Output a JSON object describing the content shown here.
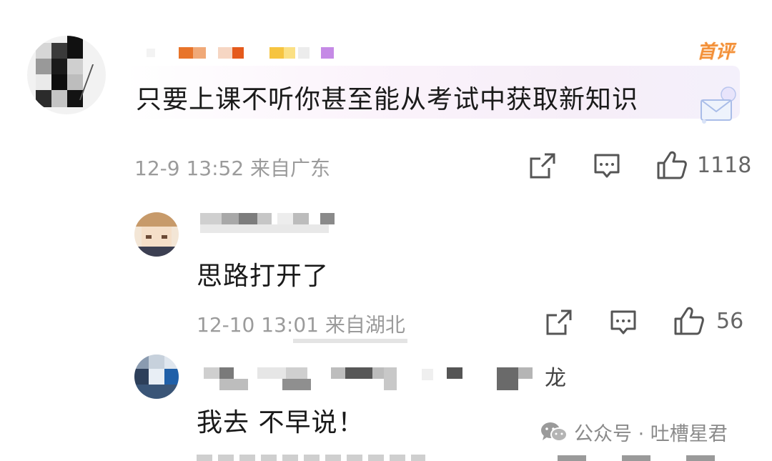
{
  "comments": [
    {
      "badge": "首评",
      "text": "只要上课不听你甚至能从考试中获取新知识",
      "time_location": "12-9 13:52 来自广东",
      "like_count": "1118"
    },
    {
      "text": "思路打开了",
      "time_location": "12-10 13:01 来自湖北",
      "like_count": "56"
    },
    {
      "name_tail": "龙",
      "text": "我去 不早说！"
    }
  ],
  "watermark": {
    "text": "公众号 · 吐槽星君"
  },
  "icons": [
    "share-icon",
    "comment-icon",
    "like-icon",
    "wechat-icon"
  ],
  "colors": {
    "badge": "#f3913a",
    "meta_text": "#9b9b9b",
    "icon_stroke": "#555555"
  }
}
